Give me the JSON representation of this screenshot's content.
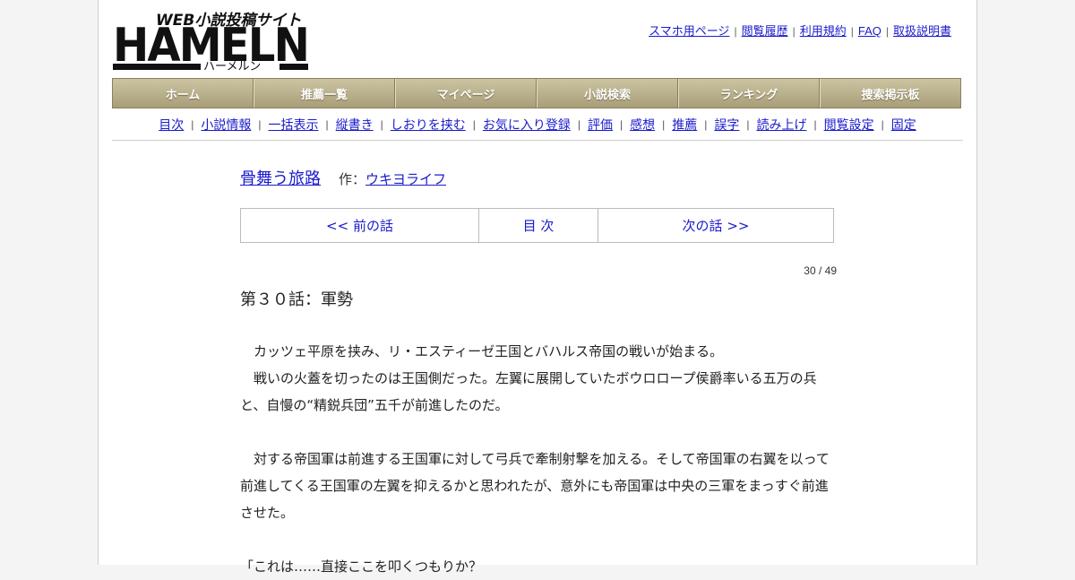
{
  "logo": {
    "tagline": "WEB小説投稿サイト",
    "name": "HAMELN",
    "kana": "ハーメルン"
  },
  "toplinks": [
    {
      "label": "スマホ用ページ"
    },
    {
      "label": "閲覧履歴"
    },
    {
      "label": "利用規約"
    },
    {
      "label": "FAQ"
    },
    {
      "label": "取扱説明書"
    }
  ],
  "mainnav": [
    {
      "label": "ホーム"
    },
    {
      "label": "推薦一覧"
    },
    {
      "label": "マイページ"
    },
    {
      "label": "小説検索"
    },
    {
      "label": "ランキング"
    },
    {
      "label": "捜索掲示板"
    }
  ],
  "subnav": [
    {
      "label": "目次"
    },
    {
      "label": "小説情報"
    },
    {
      "label": "一括表示"
    },
    {
      "label": "縦書き"
    },
    {
      "label": "しおりを挟む"
    },
    {
      "label": "お気に入り登録"
    },
    {
      "label": "評価"
    },
    {
      "label": "感想"
    },
    {
      "label": "推薦"
    },
    {
      "label": "誤字"
    },
    {
      "label": "読み上げ"
    },
    {
      "label": "閲覧設定"
    },
    {
      "label": "固定"
    }
  ],
  "novel": {
    "title": "骨舞う旅路",
    "author_prefix": "作：",
    "author": "ウキヨライフ"
  },
  "episode_nav": {
    "prev": "<< 前の話",
    "toc": "目 次",
    "next": "次の話 >>"
  },
  "page_count": "30 / 49",
  "chapter_title": "第３０話：軍勢",
  "paragraphs": [
    "カッツェ平原を挟み、リ・エスティーゼ王国とバハルス帝国の戦いが始まる。",
    "戦いの火蓋を切ったのは王国側だった。左翼に展開していたボウロロープ侯爵率いる五万の兵と、自慢の“精鋭兵団”五千が前進したのだ。",
    "",
    "対する帝国軍は前進する王国軍に対して弓兵で牽制射撃を加える。そして帝国軍の右翼を以って前進してくる王国軍の左翼を抑えるかと思われたが、意外にも帝国軍は中央の三軍をまっすぐ前進させた。",
    "",
    "「これは……直接ここを叩くつもりか？"
  ]
}
